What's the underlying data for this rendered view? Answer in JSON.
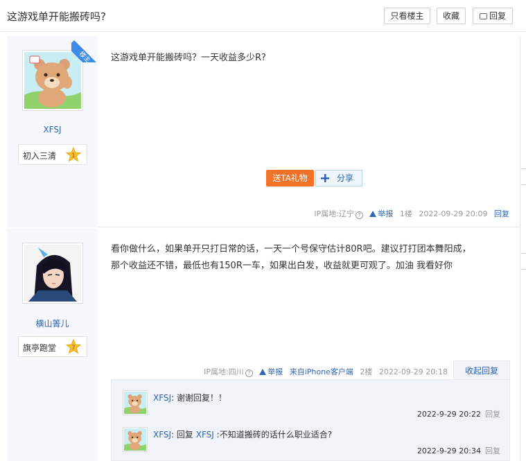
{
  "header": {
    "title": "这游戏单开能搬砖吗?",
    "btn_only_op": "只看楼主",
    "btn_favorite": "收藏",
    "btn_reply": "回复"
  },
  "posts": [
    {
      "author": "XFSJ",
      "op_badge": "楼主",
      "level_name": "初入三清",
      "level_num": "1",
      "content": "这游戏单开能搬砖吗？一天收益多少R?",
      "gift_label": "送TA礼物",
      "share_label": "分享",
      "ip": "IP属地:辽宁",
      "report": "举报",
      "floor": "1楼",
      "time": "2022-09-29 20:09",
      "reply": "回复"
    },
    {
      "author": "横山箐儿",
      "level_name": "旗亭跑堂",
      "level_num": "7",
      "content_line1": "看你做什么，如果单开只打日常的话，一天一个号保守估计80R吧。建议打打团本舞阳成，",
      "content_line2": "那个收益还不错，最低也有150R一车，如果出白发，收益就更可观了。加油 我看好你",
      "ip": "IP属地:四川",
      "report": "举报",
      "source": "来自iPhone客户端",
      "floor": "2楼",
      "time": "2022-09-29 20:18",
      "collapse": "收起回复"
    }
  ],
  "replies": [
    {
      "user": "XFSJ",
      "text": ": 谢谢回复！！",
      "time": "2022-9-29 20:22",
      "reply": "回复"
    },
    {
      "user": "XFSJ",
      "prefix": ": 回复 ",
      "target": "XFSJ",
      "text": " :不知道搬砖的话什么职业适合?",
      "time": "2022-9-29 20:34",
      "reply": "回复"
    }
  ],
  "colors": {
    "link": "#2d64b3",
    "gift": "#f27227",
    "op_badge": "#3c8ce7",
    "star": "#f6c02e"
  }
}
